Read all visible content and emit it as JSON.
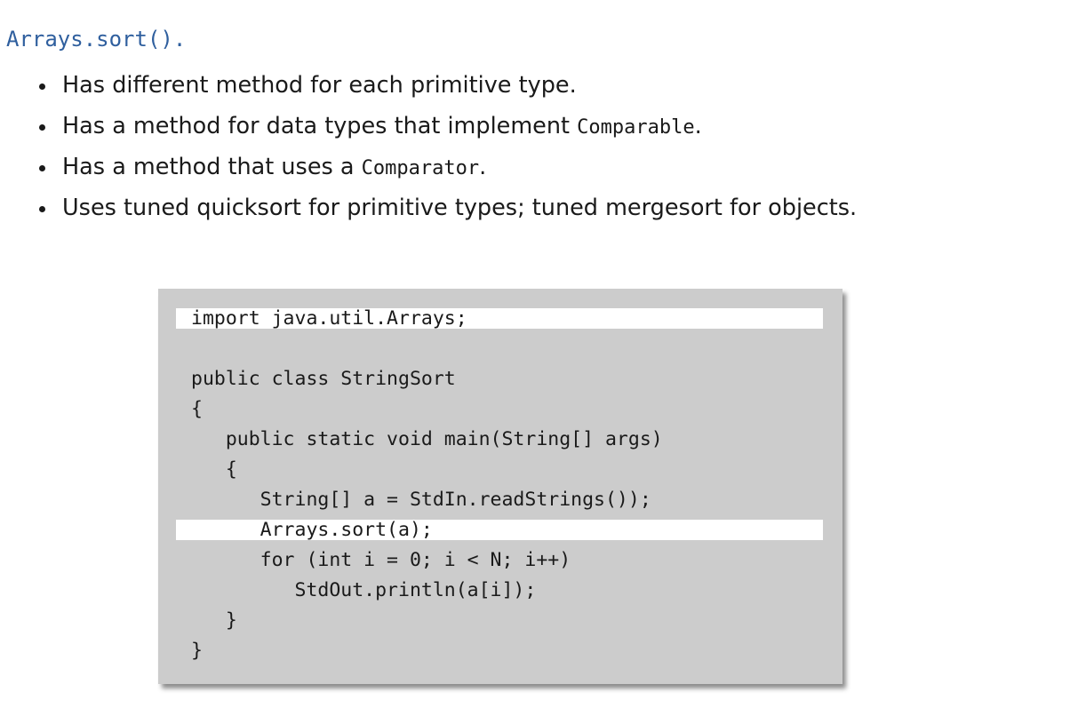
{
  "heading": "Arrays.sort().",
  "bullets": [
    {
      "text": "Has different method for each primitive type."
    },
    {
      "text_before": "Has a method for data types that implement ",
      "code": "Comparable",
      "text_after": "."
    },
    {
      "text_before": "Has a method that uses a ",
      "code": "Comparator",
      "text_after": "."
    },
    {
      "text": "Uses tuned quicksort for primitive types; tuned mergesort for objects."
    }
  ],
  "code": {
    "lines": [
      {
        "text": "import java.util.Arrays;",
        "highlighted": true
      },
      {
        "text": "",
        "highlighted": false
      },
      {
        "text": "public class StringSort",
        "highlighted": false
      },
      {
        "text": "{",
        "highlighted": false
      },
      {
        "text": "   public static void main(String[] args)",
        "highlighted": false
      },
      {
        "text": "   {",
        "highlighted": false
      },
      {
        "text": "      String[] a = StdIn.readStrings());",
        "highlighted": false
      },
      {
        "text": "      Arrays.sort(a);",
        "highlighted": true
      },
      {
        "text": "      for (int i = 0; i < N; i++)",
        "highlighted": false
      },
      {
        "text": "         StdOut.println(a[i]);",
        "highlighted": false
      },
      {
        "text": "   }",
        "highlighted": false
      },
      {
        "text": "}",
        "highlighted": false
      }
    ]
  }
}
